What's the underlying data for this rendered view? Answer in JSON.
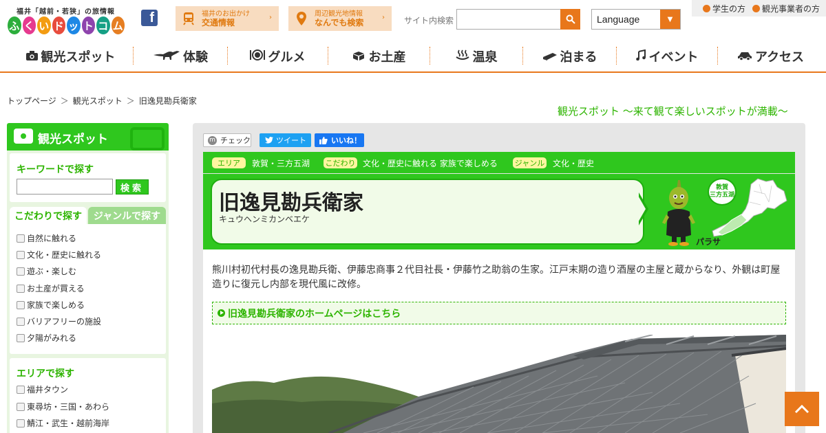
{
  "header": {
    "logo_tagline": "福井「越前・若狭」の旅情報",
    "logo_chars": [
      "ふ",
      "く",
      "い",
      "ド",
      "ッ",
      "ト",
      "コ",
      "ム"
    ],
    "logo_colors": [
      "#2cae3c",
      "#e63a8f",
      "#f39c12",
      "#e84c3d",
      "#1e88e5",
      "#8e44ad",
      "#16a085",
      "#e67e22"
    ],
    "facebook_icon": "facebook-icon",
    "traffic": {
      "line1": "福井のお出かけ",
      "line2": "交通情報",
      "icon": "train-icon"
    },
    "nearby": {
      "line1": "周辺観光地情報",
      "line2": "なんでも検索",
      "icon": "map-pin-icon"
    },
    "search_label": "サイト内検索",
    "search_value": "",
    "language_label": "Language",
    "audience": [
      "学生の方",
      "観光事業者の方"
    ],
    "accent_color": "#e8771b"
  },
  "nav": [
    {
      "label": "観光スポット",
      "icon": "camera-icon"
    },
    {
      "label": "体験",
      "icon": "dinosaur-icon"
    },
    {
      "label": "グルメ",
      "icon": "plate-icon"
    },
    {
      "label": "お土産",
      "icon": "gift-box-icon"
    },
    {
      "label": "温泉",
      "icon": "hot-spring-icon"
    },
    {
      "label": "泊まる",
      "icon": "bed-icon"
    },
    {
      "label": "イベント",
      "icon": "music-note-icon"
    },
    {
      "label": "アクセス",
      "icon": "car-icon"
    }
  ],
  "breadcrumb": [
    "トップページ",
    "観光スポット",
    "旧逸見勘兵衛家"
  ],
  "breadcrumb_sep": "＞",
  "tagline": "観光スポット 〜来て観て楽しいスポットが満載〜",
  "sidebar": {
    "title": "観光スポット",
    "keyword_title": "キーワードで探す",
    "keyword_value": "",
    "search_button": "検索",
    "tab_active": "こだわりで探す",
    "tab_inactive": "ジャンルで探す",
    "kodawari": [
      "自然に触れる",
      "文化・歴史に触れる",
      "遊ぶ・楽しむ",
      "お土産が買える",
      "家族で楽しめる",
      "バリアフリーの施設",
      "夕陽がみれる"
    ],
    "area_title": "エリアで探す",
    "areas": [
      "福井タウン",
      "東尋坊・三国・あわら",
      "鯖江・武生・越前海岸"
    ],
    "brand_green": "#2fc71e"
  },
  "social": {
    "check": "チェック",
    "tweet": "ツイート",
    "like": "いいね！"
  },
  "spot": {
    "area_label": "エリア",
    "area_value": "敦賀・三方五湖",
    "kodawari_label": "こだわり",
    "kodawari_value": "文化・歴史に触れる 家族で楽しめる",
    "genre_label": "ジャンル",
    "genre_value": "文化・歴史",
    "title": "旧逸見勘兵衛家",
    "kana": "キュウヘンミカンベエケ",
    "mascot_name": "パラサ",
    "area_badge": [
      "敦賀",
      "三方五湖"
    ],
    "description": "熊川村初代村長の逸見勘兵衛、伊藤忠商事２代目社長・伊藤竹之助翁の生家。江戸末期の造り酒屋の主屋と蔵からなり、外観は町屋造りに復元し内部を現代風に改修。",
    "homepage_link": "旧逸見勘兵衛家のホームページはこちら"
  },
  "to_top_icon": "chevron-up-icon"
}
